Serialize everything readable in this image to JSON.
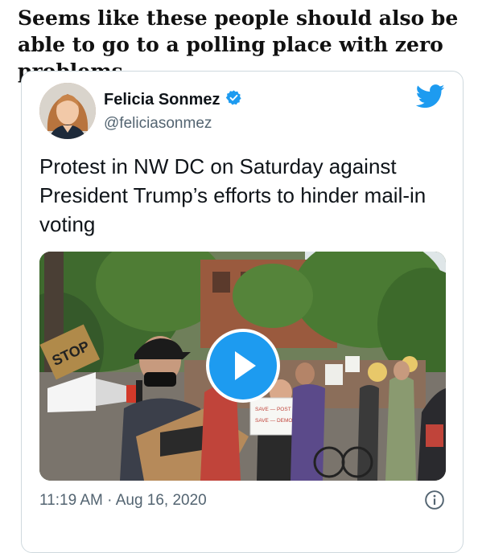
{
  "caption": "Seems like these people should also be able to go to a polling place with zero problems.",
  "tweet": {
    "author_name": "Felicia Sonmez",
    "handle": "@feliciasonmez",
    "verified": true,
    "text": "Protest in NW DC on Saturday against President Trump’s efforts to hinder mail-in voting",
    "timestamp": "11:19 AM · Aug 16, 2020",
    "media": {
      "type": "video",
      "sign_stop": "STOP",
      "sign_protest_line1": "SAVE — POST OFFICE",
      "sign_protest_line2": "SAVE — DEMOCRACY"
    }
  },
  "colors": {
    "twitter_blue": "#1d9bf0",
    "text_primary": "#0f1419",
    "text_secondary": "#536471",
    "border": "#cfd9de"
  },
  "icons": [
    "verified-badge-icon",
    "twitter-bird-icon",
    "play-icon",
    "info-icon"
  ]
}
